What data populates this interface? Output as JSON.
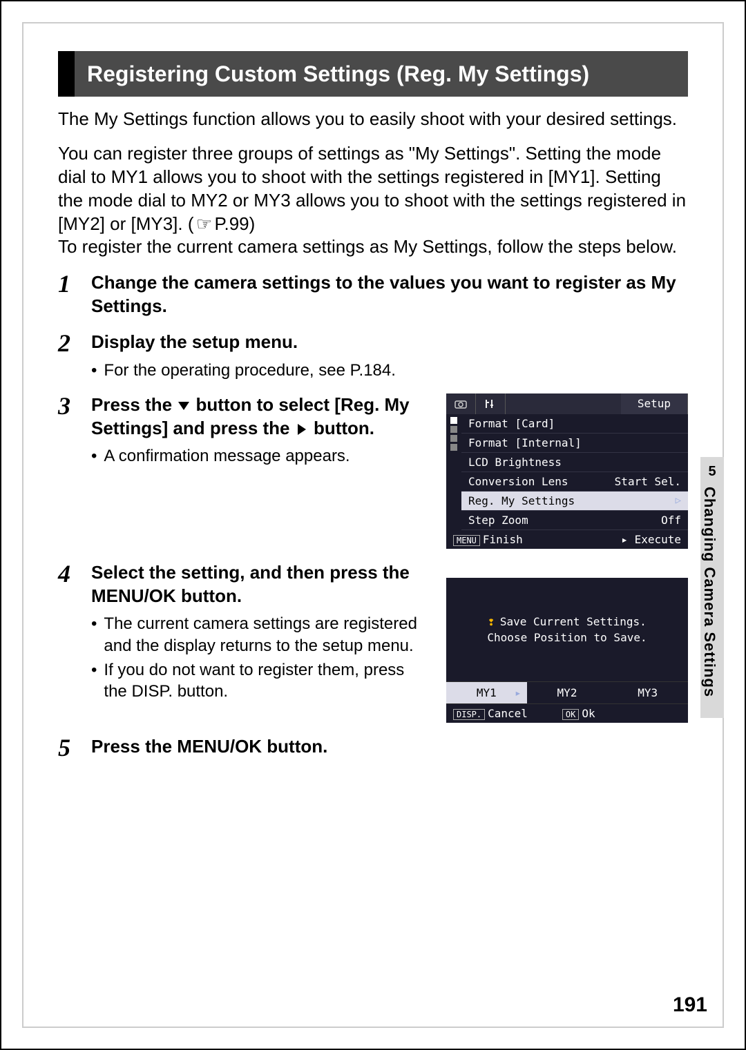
{
  "title": "Registering Custom Settings (Reg. My Settings)",
  "intro_p1": "The My Settings function allows you to easily shoot with your desired settings.",
  "intro_p2a": "You can register three groups of settings as \"My Settings\". Setting the mode dial to MY1 allows you to shoot with the settings registered in [MY1]. Setting the mode dial to MY2 or MY3 allows you to shoot with the settings registered in [MY2] or [MY3]. (",
  "intro_p2_ref": "P.99",
  "intro_p2b": ")",
  "intro_p3": "To register the current camera settings as My Settings, follow the steps below.",
  "steps": {
    "s1": {
      "num": "1",
      "title": "Change the camera settings to the values you want to register as My Settings."
    },
    "s2": {
      "num": "2",
      "title": "Display the setup menu.",
      "bullet1": "For the operating procedure, see P.184."
    },
    "s3": {
      "num": "3",
      "title_a": "Press the ",
      "title_b": " button to select [Reg. My Settings] and press the ",
      "title_c": " button.",
      "bullet1": "A confirmation message appears."
    },
    "s4": {
      "num": "4",
      "title": "Select the setting, and then press the MENU/OK button.",
      "bullet1": "The current camera settings are registered and the display returns to the setup menu.",
      "bullet2": "If you do not want to register them, press the DISP. button."
    },
    "s5": {
      "num": "5",
      "title": "Press the MENU/OK button."
    }
  },
  "screen1": {
    "tab_setup": "Setup",
    "rows": {
      "r1": {
        "label": "Format [Card]",
        "value": ""
      },
      "r2": {
        "label": "Format [Internal]",
        "value": ""
      },
      "r3": {
        "label": "LCD Brightness",
        "value": ""
      },
      "r4": {
        "label": "Conversion Lens",
        "value": "Start Sel."
      },
      "r5": {
        "label": "Reg. My Settings",
        "value": ""
      },
      "r6": {
        "label": "Step Zoom",
        "value": "Off"
      }
    },
    "footer": {
      "menu_btn": "MENU",
      "finish": "Finish",
      "execute": "Execute"
    }
  },
  "screen2": {
    "msg_line1": "Save Current Settings.",
    "msg_line2": "Choose Position to Save.",
    "choices": {
      "c1": "MY1",
      "c2": "MY2",
      "c3": "MY3"
    },
    "footer": {
      "disp_btn": "DISP.",
      "cancel": "Cancel",
      "ok_btn": "OK",
      "ok": "Ok"
    }
  },
  "side": {
    "chapter_num": "5",
    "chapter_title": "Changing Camera Settings"
  },
  "page_number": "191"
}
